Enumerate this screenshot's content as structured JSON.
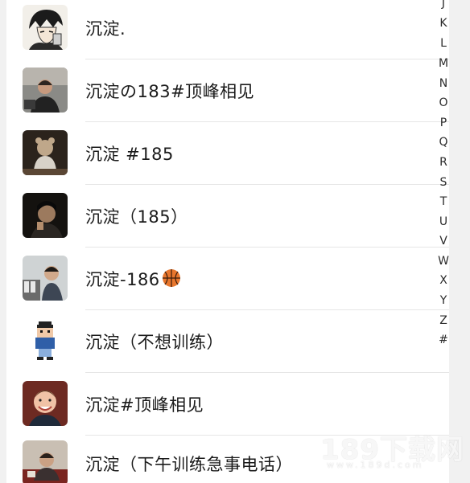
{
  "contacts": [
    {
      "name": "沉淀.",
      "avatar": "anime-character-avatar"
    },
    {
      "name": "沉淀の183#顶峰相见",
      "avatar": "person-at-desk-avatar"
    },
    {
      "name": "沉淀 #185",
      "avatar": "person-with-bear-avatar"
    },
    {
      "name": "沉淀（185）",
      "avatar": "dark-portrait-avatar"
    },
    {
      "name": "沉淀-186",
      "avatar": "person-in-room-avatar",
      "emoji": "basketball-icon"
    },
    {
      "name": "沉淀（不想训练）",
      "avatar": "pixel-character-avatar"
    },
    {
      "name": "沉淀#顶峰相见",
      "avatar": "smiling-child-avatar"
    },
    {
      "name": "沉淀（下午训练急事电话）",
      "avatar": "person-on-phone-avatar"
    }
  ],
  "index_letters": [
    "J",
    "K",
    "L",
    "M",
    "N",
    "O",
    "P",
    "Q",
    "R",
    "S",
    "T",
    "U",
    "V",
    "W",
    "X",
    "Y",
    "Z",
    "#"
  ],
  "watermark": {
    "main": "189下载网",
    "sub": "www.189d.com"
  }
}
